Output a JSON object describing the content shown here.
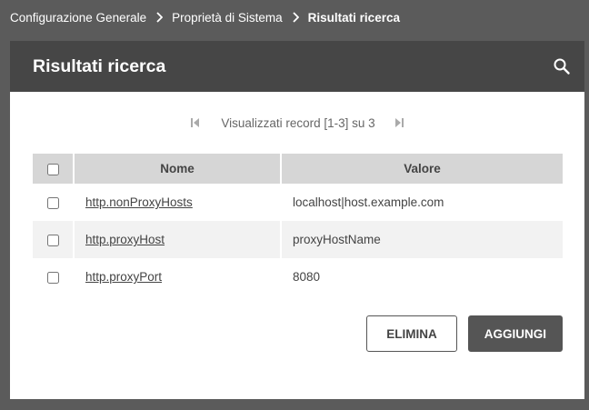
{
  "breadcrumb": {
    "items": [
      "Configurazione Generale",
      "Proprietà di Sistema"
    ],
    "current": "Risultati ricerca"
  },
  "panel": {
    "title": "Risultati ricerca",
    "search_icon": "search-icon"
  },
  "pager": {
    "label": "Visualizzati record [1-3] su 3",
    "first_icon": "first-page-icon",
    "last_icon": "last-page-icon"
  },
  "table": {
    "columns": [
      "Nome",
      "Valore"
    ],
    "rows": [
      {
        "name": "http.nonProxyHosts",
        "value": "localhost|host.example.com",
        "checked": false
      },
      {
        "name": "http.proxyHost",
        "value": "proxyHostName",
        "checked": false
      },
      {
        "name": "http.proxyPort",
        "value": "8080",
        "checked": false
      }
    ]
  },
  "actions": {
    "delete_label": "ELIMINA",
    "add_label": "AGGIUNGI"
  },
  "colors": {
    "background": "#5b5b5b",
    "header": "#464646",
    "table_header": "#d6d6d6",
    "row_alt": "#f2f2f2",
    "primary_button": "#555555"
  }
}
